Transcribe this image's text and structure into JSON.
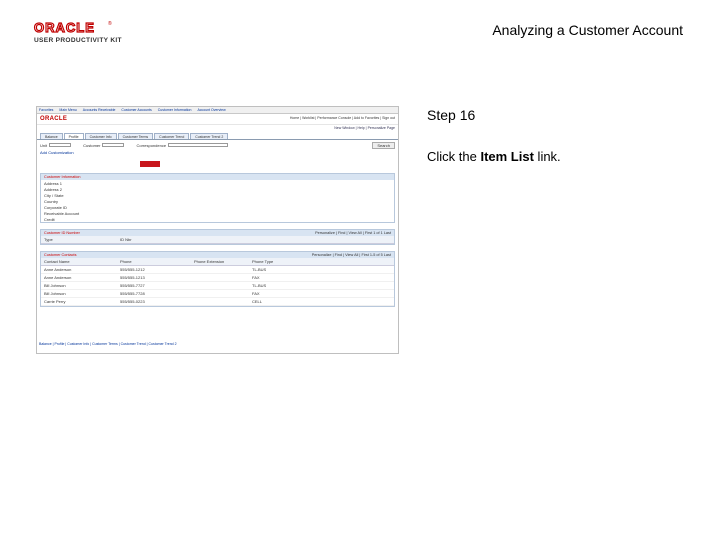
{
  "logo": {
    "brand": "ORACLE",
    "tm": "®",
    "product": "USER PRODUCTIVITY KIT"
  },
  "header": {
    "title": "Analyzing a Customer Account"
  },
  "screenshot": {
    "nav": [
      "Favorites",
      "Main Menu",
      "Accounts Receivable",
      "Customer Accounts",
      "Customer Information",
      "Account Overview"
    ],
    "brand": "ORACLE",
    "home_links": "Home | Worklist | Performance Console | Add to Favorites | Sign out",
    "tools": "New Window | Help | Personalize Page",
    "tabs": [
      "Balance",
      "Profile",
      "Customer Info",
      "Customer Terms",
      "Customer Trend",
      "Customer Trend 2"
    ],
    "filters": [
      "Unit",
      "Customer",
      "Correspondence"
    ],
    "search_label": "Search",
    "add_customization": "Add Customization",
    "section1_title": "Customer Information",
    "section1_rows": [
      "Address 1",
      "Address 2",
      "City / State",
      "Country",
      "Corporate ID",
      "Receivable Account",
      "Credit"
    ],
    "section2_title": "Customer ID Number",
    "section2_nav": "Personalize | Find | View All | First 1 of 1 Last",
    "section2_cols": [
      "Type",
      "ID Nbr"
    ],
    "section3_title": "Customer Contacts",
    "section3_nav": "Personalize | Find | View All | First 1-5 of 5 Last",
    "section3_cols": [
      "Contact Name",
      "Phone",
      "Phone Extension",
      "Phone Type"
    ],
    "contacts": [
      [
        "Anne Anderson",
        "555/555-1212",
        "",
        "TL-BUS"
      ],
      [
        "Anne Anderson",
        "555/555-1213",
        "",
        "FAX"
      ],
      [
        "Bill Johnson",
        "555/555-7727",
        "",
        "TL-BUS"
      ],
      [
        "Bill Johnson",
        "555/555-7728",
        "",
        "FAX"
      ],
      [
        "Carrie Perry",
        "555/555-0223",
        "",
        "CELL"
      ]
    ],
    "footer_links": "Balance | Profile | Customer Info | Customer Terms | Customer Trend | Customer Trend 2"
  },
  "step": {
    "label": "Step 16"
  },
  "instruction": {
    "before": "Click the ",
    "bold": "Item List",
    "after": " link."
  }
}
